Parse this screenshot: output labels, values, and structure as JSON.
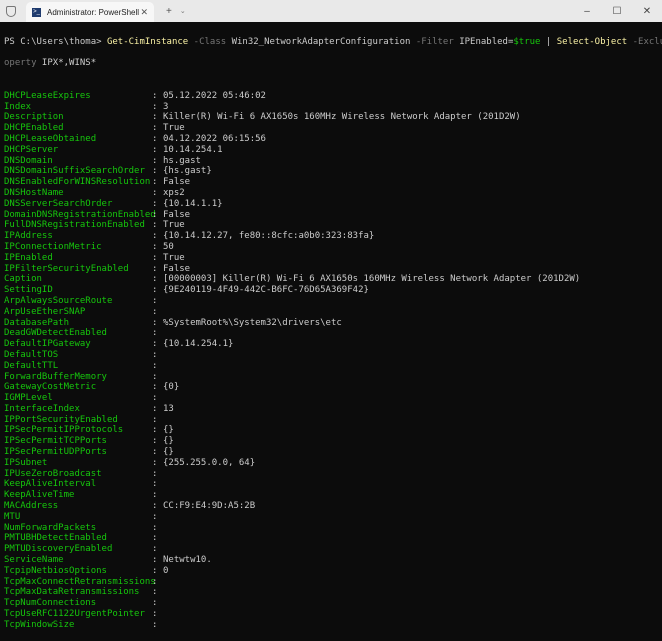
{
  "window": {
    "tab_title": "Administrator: PowerShell",
    "tab_icon": "powershell-icon",
    "new_tab": "+",
    "dropdown": "⌄",
    "minimize": "–",
    "maximize": "☐",
    "close": "✕",
    "tab_close": "✕"
  },
  "command": {
    "prompt": "PS C:\\Users\\thoma> ",
    "cmdlet1": "Get-CimInstance",
    "p1": " -Class ",
    "a1": "Win32_NetworkAdapterConfiguration",
    "p2": " -Filter ",
    "a2": "IPEnabled=",
    "var": "$true",
    "pipe": " | ",
    "cmdlet2": "Select-Object",
    "p3": " -ExcludePr",
    "p3b": "operty",
    "a3": " IPX*,WINS*"
  },
  "properties": [
    {
      "name": "DHCPLeaseExpires",
      "value": "05.12.2022 05:46:02"
    },
    {
      "name": "Index",
      "value": "3"
    },
    {
      "name": "Description",
      "value": "Killer(R) Wi-Fi 6 AX1650s 160MHz Wireless Network Adapter (201D2W)"
    },
    {
      "name": "DHCPEnabled",
      "value": "True"
    },
    {
      "name": "DHCPLeaseObtained",
      "value": "04.12.2022 06:15:56"
    },
    {
      "name": "DHCPServer",
      "value": "10.14.254.1"
    },
    {
      "name": "DNSDomain",
      "value": "hs.gast"
    },
    {
      "name": "DNSDomainSuffixSearchOrder",
      "value": "{hs.gast}"
    },
    {
      "name": "DNSEnabledForWINSResolution",
      "value": "False"
    },
    {
      "name": "DNSHostName",
      "value": "xps2"
    },
    {
      "name": "DNSServerSearchOrder",
      "value": "{10.14.1.1}"
    },
    {
      "name": "DomainDNSRegistrationEnabled",
      "value": "False"
    },
    {
      "name": "FullDNSRegistrationEnabled",
      "value": "True"
    },
    {
      "name": "IPAddress",
      "value": "{10.14.12.27, fe80::8cfc:a0b0:323:83fa}"
    },
    {
      "name": "IPConnectionMetric",
      "value": "50"
    },
    {
      "name": "IPEnabled",
      "value": "True"
    },
    {
      "name": "IPFilterSecurityEnabled",
      "value": "False"
    },
    {
      "name": "Caption",
      "value": "[00000003] Killer(R) Wi-Fi 6 AX1650s 160MHz Wireless Network Adapter (201D2W)"
    },
    {
      "name": "SettingID",
      "value": "{9E240119-4F49-442C-B6FC-76D65A369F42}"
    },
    {
      "name": "ArpAlwaysSourceRoute",
      "value": ""
    },
    {
      "name": "ArpUseEtherSNAP",
      "value": ""
    },
    {
      "name": "DatabasePath",
      "value": "%SystemRoot%\\System32\\drivers\\etc"
    },
    {
      "name": "DeadGWDetectEnabled",
      "value": ""
    },
    {
      "name": "DefaultIPGateway",
      "value": "{10.14.254.1}"
    },
    {
      "name": "DefaultTOS",
      "value": ""
    },
    {
      "name": "DefaultTTL",
      "value": ""
    },
    {
      "name": "ForwardBufferMemory",
      "value": ""
    },
    {
      "name": "GatewayCostMetric",
      "value": "{0}"
    },
    {
      "name": "IGMPLevel",
      "value": ""
    },
    {
      "name": "InterfaceIndex",
      "value": "13"
    },
    {
      "name": "IPPortSecurityEnabled",
      "value": ""
    },
    {
      "name": "IPSecPermitIPProtocols",
      "value": "{}"
    },
    {
      "name": "IPSecPermitTCPPorts",
      "value": "{}"
    },
    {
      "name": "IPSecPermitUDPPorts",
      "value": "{}"
    },
    {
      "name": "IPSubnet",
      "value": "{255.255.0.0, 64}"
    },
    {
      "name": "IPUseZeroBroadcast",
      "value": ""
    },
    {
      "name": "KeepAliveInterval",
      "value": ""
    },
    {
      "name": "KeepAliveTime",
      "value": ""
    },
    {
      "name": "MACAddress",
      "value": "CC:F9:E4:9D:A5:2B"
    },
    {
      "name": "MTU",
      "value": ""
    },
    {
      "name": "NumForwardPackets",
      "value": ""
    },
    {
      "name": "PMTUBHDetectEnabled",
      "value": ""
    },
    {
      "name": "PMTUDiscoveryEnabled",
      "value": ""
    },
    {
      "name": "ServiceName",
      "value": "Netwtw10."
    },
    {
      "name": "TcpipNetbiosOptions",
      "value": "0"
    },
    {
      "name": "TcpMaxConnectRetransmissions",
      "value": ""
    },
    {
      "name": "TcpMaxDataRetransmissions",
      "value": ""
    },
    {
      "name": "TcpNumConnections",
      "value": ""
    },
    {
      "name": "TcpUseRFC1122UrgentPointer",
      "value": ""
    },
    {
      "name": "TcpWindowSize",
      "value": ""
    }
  ],
  "separator": ":"
}
